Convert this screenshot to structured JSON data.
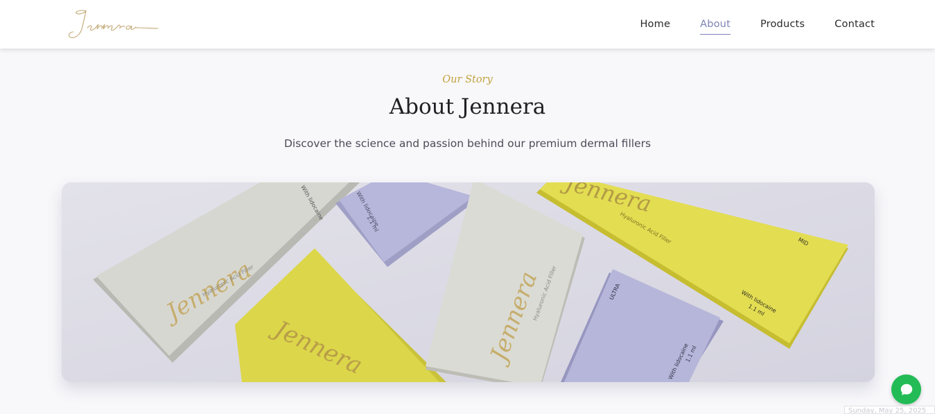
{
  "header": {
    "logo_text": "Jennera",
    "nav": [
      {
        "label": "Home",
        "active": false
      },
      {
        "label": "About",
        "active": true
      },
      {
        "label": "Products",
        "active": false
      },
      {
        "label": "Contact",
        "active": false
      }
    ]
  },
  "hero": {
    "eyebrow": "Our Story",
    "title": "About Jennera",
    "subtitle": "Discover the science and passion behind our premium dermal fillers"
  },
  "image": {
    "box_brand": "Jennera",
    "box_product": "Hyaluronic Acid Filler",
    "box_lidocaine": "With lidocaine",
    "box_volume": "1.1 ml",
    "box_variant_mid": "MID",
    "box_variant_ultra": "ULTRA"
  },
  "chat": {
    "icon": "chat-bubble-icon"
  },
  "date_stamp": "Sunday, May 25, 2025",
  "colors": {
    "accent": "#7d84b5",
    "gold": "#c2a13c",
    "chat_green": "#22bb55",
    "box_yellow": "#e4de4c",
    "box_lavender": "#b9b9dc",
    "box_grey": "#d9d9d3"
  }
}
